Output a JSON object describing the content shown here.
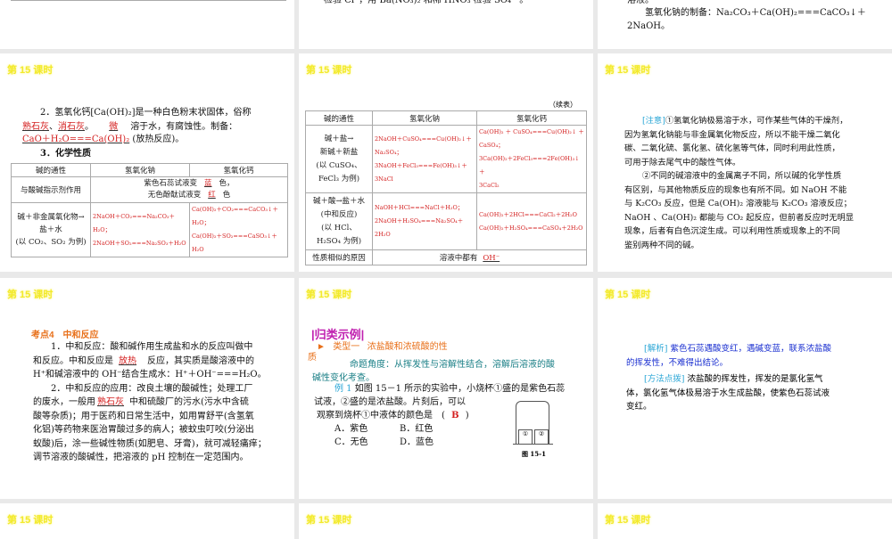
{
  "slide_title": "第 15 课时",
  "r1c2": {
    "line": "检验 Cl⁻，用 Ba(NO₃)₂ 和稀 HNO₃ 检验 SO₄²⁻。"
  },
  "r1c3": {
    "line0": "溶液。",
    "line1": "氢氧化钠的制备：Na₂CO₃＋Ca(OH)₂===CaCO₃↓＋",
    "line2": "2NaOH。"
  },
  "r2c1": {
    "p1": "2．氢氧化钙[Ca(OH)₂]是一种白色粉末状固体，俗称",
    "b1": "熟石灰",
    "sep1": "、",
    "b2": "消石灰",
    "sep2": "。",
    "b3": "微",
    "t2": "溶于水，有腐蚀性。制备：",
    "b4": "CaO＋H₂O===Ca(OH)₂",
    "t3": "(放热反应)。",
    "h3": "3．化学性质",
    "table": {
      "headers": [
        "碱的通性",
        "氢氧化钠",
        "氢氧化钙"
      ],
      "row1_label": "与酸碱指示剂作用",
      "row1_a": "紫色石蕊试液变",
      "row1_a_blank": "蓝",
      "row1_a_end": "色，",
      "row1_b": "无色酚酞试液变",
      "row1_b_blank": "红",
      "row1_b_end": "色",
      "row2_label": [
        "碱＋非金属氧化物→",
        "盐＋水",
        "(以 CO₂、SO₂ 为例)"
      ],
      "row2_naoh": [
        "2NaOH＋CO₂===Na₂CO₃＋H₂O；",
        "2NaOH＋SO₂===Na₂SO₃＋H₂O"
      ],
      "row2_caoh": [
        "Ca(OH)₂＋CO₂===CaCO₃↓＋H₂O；",
        "Ca(OH)₂＋SO₂===CaSO₃↓＋H₂O"
      ]
    }
  },
  "r2c2": {
    "cont": "（续表）",
    "headers": [
      "碱的通性",
      "氢氧化钠",
      "氢氧化钙"
    ],
    "row1_label": [
      "碱＋盐→",
      "新碱＋新盐",
      "(以 CuSO₄、",
      "FeCl₃ 为例)"
    ],
    "row1_naoh": [
      "2NaOH＋CuSO₄===Cu(OH)₂↓＋",
      "Na₂SO₄；",
      "3NaOH＋FeCl₃===Fe(OH)₃↓＋",
      "3NaCl"
    ],
    "row1_caoh": [
      "Ca(OH)₂ ＋ CuSO₄===Cu(OH)₂↓ ＋",
      "CaSO₄；",
      "3Ca(OH)₂＋2FeCl₃===2Fe(OH)₃↓＋",
      "3CaCl₂"
    ],
    "row2_label": [
      "碱＋酸→盐＋水",
      "(中和反应)",
      "(以 HCl、",
      "H₂SO₄ 为例)"
    ],
    "row2_naoh": [
      "NaOH＋HCl===NaCl＋H₂O；",
      "2NaOH＋H₂SO₄===Na₂SO₄＋2H₂O"
    ],
    "row2_caoh": [
      "Ca(OH)₂＋2HCl===CaCl₂＋2H₂O",
      "Ca(OH)₂＋H₂SO₄===CaSO₄＋2H₂O"
    ],
    "row3_label": "性质相似的原因",
    "row3_text": "溶液中都有",
    "row3_blank": "OH⁻"
  },
  "r2c3": {
    "tag": "[注意]",
    "lines": [
      "①氢氧化钠极易溶于水，可作某些气体的干燥剂，",
      "因为氢氧化钠能与非金属氧化物反应，所以不能干燥二氧化",
      "碳、二氧化硫、氯化氢、硫化氢等气体，同时利用此性质，",
      "可用于除去尾气中的酸性气体。",
      "②不同的碱溶液中的金属离子不同，所以碱的化学性质",
      "有区别，与其他物质反应的现象也有所不同。如 NaOH 不能",
      "与 K₂CO₃ 反应，但是 Ca(OH)₂ 溶液能与 K₂CO₃ 溶液反应；",
      "NaOH 、Ca(OH)₂ 都能与 CO₂ 起反应，但前者反应时无明显",
      "现象，后者有白色沉淀生成。可以利用性质或现象上的不同",
      "鉴别两种不同的碱。"
    ]
  },
  "r3c1": {
    "heading": "考点4　中和反应",
    "l1": "1．中和反应：酸和碱作用生成盐和水的反应叫做中",
    "l2a": "和反应。中和反应是",
    "l2b": "放热",
    "l2c": "反应，其实质是酸溶液中的",
    "l3": "H⁺和碱溶液中的 OH⁻结合生成水：H⁺＋OH⁻===H₂O。",
    "l4": "2．中和反应的应用：改良土壤的酸碱性；处理工厂",
    "l5a": "的废水，一般用",
    "l5b": "熟石灰",
    "l5c": "中和硫酸厂的污水(污水中含硫",
    "l6": "酸等杂质)；用于医药和日常生活中，如用胃舒平(含氢氧",
    "l7": "化铝)等药物来医治胃酸过多的病人；被蚊虫叮咬(分泌出",
    "l8": "蚁酸)后，涂一些碱性物质(如肥皂、牙膏)，就可减轻痛痒；",
    "l9": "调节溶液的酸碱性，把溶液的 pH 控制在一定范围内。"
  },
  "r3c2": {
    "badge": "|归类示例|",
    "type_label": "类型一",
    "type_title": "浓盐酸和浓硫酸的性",
    "type_title2": "质",
    "angle1": "命题角度：从挥发性与溶解性结合，溶解后溶液的酸",
    "angle2": "碱性变化考查。",
    "ex_label": "例 1",
    "q1": "如图 15－1 所示的实验中，小烧杯①盛的是紫色石蕊",
    "q2": "试液，②盛的是浓盐酸。片刻后，可以",
    "q3": "观察到烧杯①中液体的颜色是　(",
    "answer": "B",
    "q3end": ")",
    "options": [
      "A．紫色",
      "B．红色",
      "C．无色",
      "D．蓝色"
    ],
    "fig_caption": "图 15-1",
    "beaker1": "①",
    "beaker2": "②"
  },
  "r3c3": {
    "tag1": "[解析]",
    "a1": "紫色石蕊遇酸变红，遇碱变蓝，联系浓盐酸",
    "a2": "的挥发性，不难得出结论。",
    "tag2": "[方法点拨]",
    "m1": "浓盐酸的挥发性，挥发的是氯化氢气",
    "m2": "体，氯化氢气体极易溶于水生成盐酸，使紫色石蕊试液",
    "m3": "变红。"
  }
}
